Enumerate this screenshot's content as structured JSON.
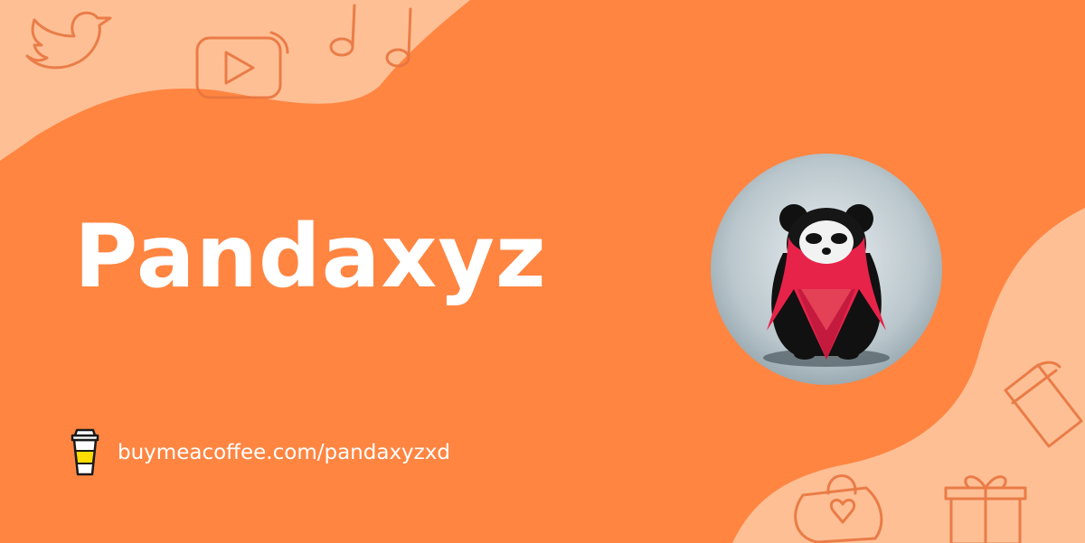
{
  "creator": {
    "name": "Pandaxyz"
  },
  "link": {
    "url": "buymeacoffee.com/pandaxyzxd"
  },
  "icons": {
    "cup": "coffee-cup-icon",
    "doodles": [
      "twitter-bird-icon",
      "youtube-play-icon",
      "music-note-icon",
      "coffee-mug-icon",
      "heart-bag-icon",
      "gift-box-icon"
    ]
  },
  "colors": {
    "background": "#ff8541",
    "blob": "#ffbf95",
    "text": "#ffffff"
  }
}
